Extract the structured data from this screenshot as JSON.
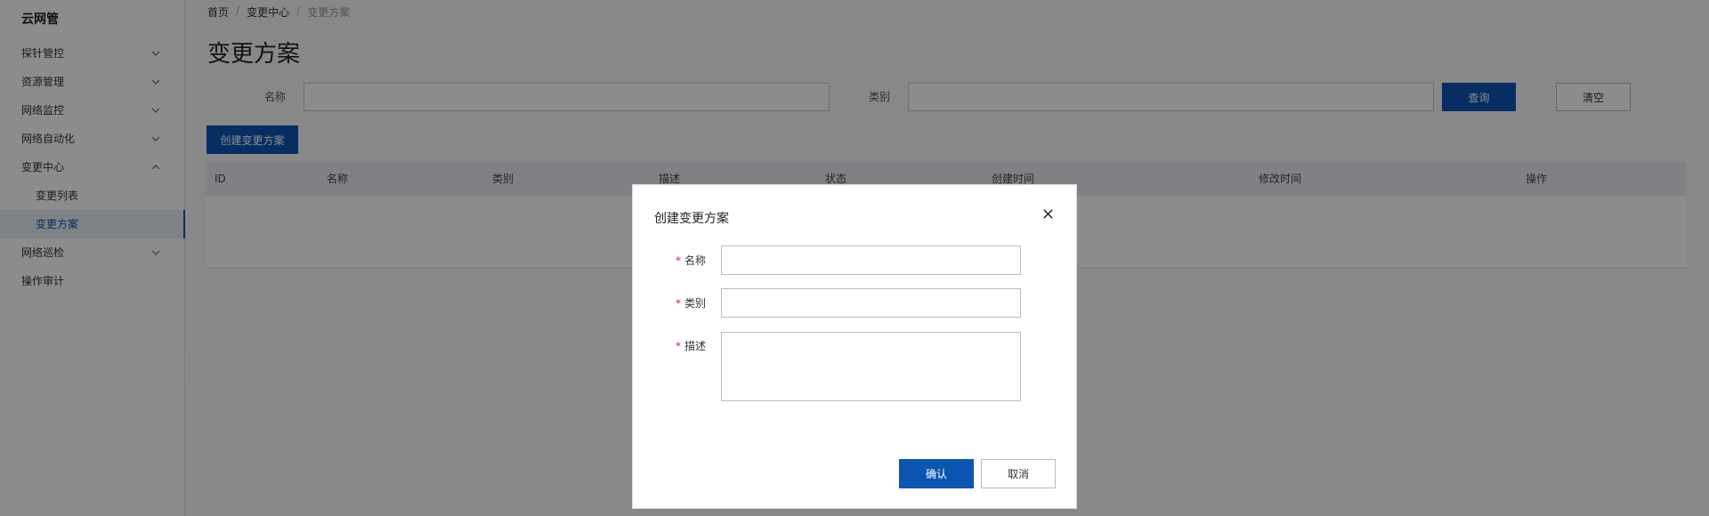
{
  "app": {
    "title": "云网管"
  },
  "sidebar": {
    "items": [
      {
        "label": "探针管控",
        "expandable": true,
        "expanded": false
      },
      {
        "label": "资源管理",
        "expandable": true,
        "expanded": false
      },
      {
        "label": "网络监控",
        "expandable": true,
        "expanded": false
      },
      {
        "label": "网络自动化",
        "expandable": true,
        "expanded": false
      },
      {
        "label": "变更中心",
        "expandable": true,
        "expanded": true,
        "children": [
          {
            "label": "变更列表",
            "active": false
          },
          {
            "label": "变更方案",
            "active": true
          }
        ]
      },
      {
        "label": "网络巡检",
        "expandable": true,
        "expanded": false
      },
      {
        "label": "操作审计",
        "expandable": false
      }
    ],
    "collapse_icon": "arrow-left-icon"
  },
  "breadcrumb": {
    "home": "首页",
    "parent": "变更中心",
    "current": "变更方案",
    "separator": "/"
  },
  "page": {
    "title": "变更方案"
  },
  "filters": {
    "name_label": "名称",
    "name_value": "",
    "category_label": "类别",
    "category_value": "",
    "search_button": "查询",
    "clear_button": "清空"
  },
  "toolbar": {
    "create_button": "创建变更方案"
  },
  "table": {
    "columns": [
      "ID",
      "名称",
      "类别",
      "描述",
      "状态",
      "创建时间",
      "修改时间",
      "操作"
    ],
    "rows": []
  },
  "modal": {
    "title": "创建变更方案",
    "required_mark": "*",
    "fields": {
      "name_label": "名称",
      "name_value": "",
      "category_label": "类别",
      "category_value": "",
      "description_label": "描述",
      "description_value": ""
    },
    "confirm_button": "确认",
    "cancel_button": "取消",
    "close_icon": "close-icon"
  },
  "colors": {
    "primary": "#0b55b2",
    "required": "#e02020",
    "overlay": "rgba(0,0,0,0.45)"
  }
}
